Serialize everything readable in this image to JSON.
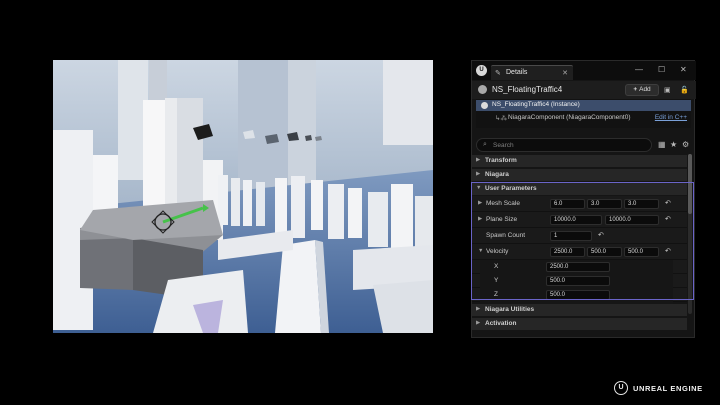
{
  "window": {
    "tab_label": "Details",
    "tab_icon": "pencil-icon",
    "minimize_glyph": "—",
    "maximize_glyph": "☐",
    "close_glyph": "✕",
    "tab_close_glyph": "✕"
  },
  "actor": {
    "name": "NS_FloatingTraffic4",
    "add_label": "Add",
    "add_glyph": "+"
  },
  "components": {
    "selected_label": "NS_FloatingTraffic4 (Instance)",
    "child_label": "NiagaraComponent (NiagaraComponent0)",
    "edit_link": "Edit in C++"
  },
  "search": {
    "placeholder": "Search",
    "glyph": "⌕"
  },
  "categories": {
    "transform": "Transform",
    "niagara": "Niagara",
    "user_parameters": "User Parameters",
    "niagara_utilities": "Niagara Utilities",
    "activation": "Activation"
  },
  "properties": {
    "mesh_scale": {
      "label": "Mesh Scale",
      "values": [
        "6.0",
        "3.0",
        "3.0"
      ]
    },
    "plane_size": {
      "label": "Plane Size",
      "values": [
        "10000.0",
        "10000.0"
      ]
    },
    "spawn_count": {
      "label": "Spawn Count",
      "value": "1"
    },
    "velocity": {
      "label": "Velocity",
      "values": [
        "2500.0",
        "500.0",
        "500.0"
      ],
      "x_label": "X",
      "x_value": "2500.0",
      "y_label": "Y",
      "y_value": "500.0",
      "z_label": "Z",
      "z_value": "500.0"
    }
  },
  "glyphs": {
    "expanded": "▼",
    "collapsed": "▶",
    "reset": "↶",
    "grid": "▦",
    "star": "★",
    "gear": "⚙"
  },
  "brand": {
    "logo_letter": "U",
    "text": "UNREAL ENGINE"
  },
  "colors": {
    "highlight": "#6a64c8",
    "selection": "#3c4d6b",
    "gizmo_green": "#46c24a"
  }
}
